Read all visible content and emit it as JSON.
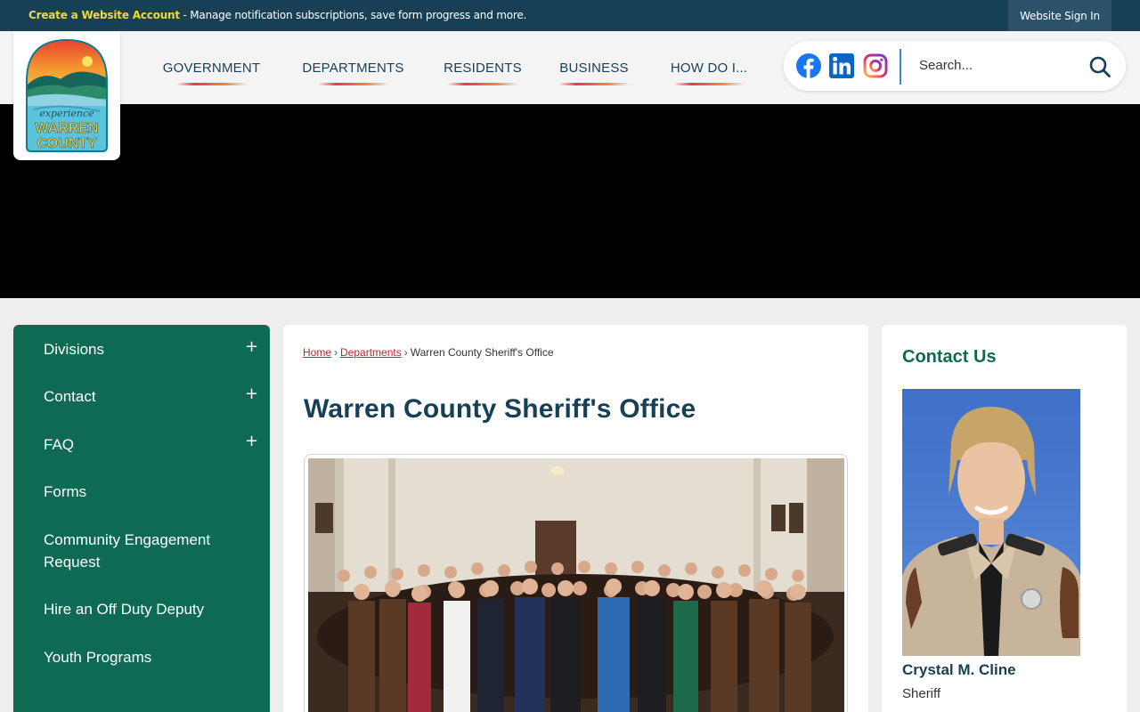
{
  "topbar": {
    "create_account": "Create a Website Account",
    "message": " - Manage notification subscriptions, save form progress and more.",
    "signin": "Website Sign In"
  },
  "logo": {
    "line1": "experience",
    "line2": "WARREN",
    "line3": "COUNTY"
  },
  "nav": {
    "items": [
      "GOVERNMENT",
      "DEPARTMENTS",
      "RESIDENTS",
      "BUSINESS",
      "HOW DO I..."
    ]
  },
  "social": {
    "facebook": "facebook-icon",
    "linkedin": "linkedin-icon",
    "instagram": "instagram-icon"
  },
  "search": {
    "placeholder": "Search..."
  },
  "sidebar": {
    "items": [
      {
        "label": "Divisions",
        "expandable": "+"
      },
      {
        "label": "Contact",
        "expandable": "+"
      },
      {
        "label": "FAQ",
        "expandable": "+"
      },
      {
        "label": "Forms"
      },
      {
        "label": "Community Engagement Request"
      },
      {
        "label": "Hire an Off Duty Deputy"
      },
      {
        "label": "Youth Programs"
      }
    ]
  },
  "breadcrumb": {
    "home": "Home",
    "departments": "Departments",
    "current": "Warren County Sheriff's Office",
    "separator": "›"
  },
  "main": {
    "title": "Warren County Sheriff's Office"
  },
  "contact": {
    "title": "Contact Us",
    "name": "Crystal M. Cline",
    "role": "Sheriff"
  },
  "colors": {
    "topbar": "#173f56",
    "accent_yellow": "#f5d63d",
    "sidebar": "#0f6a54",
    "title": "#173f56",
    "link": "#b22a2a"
  }
}
